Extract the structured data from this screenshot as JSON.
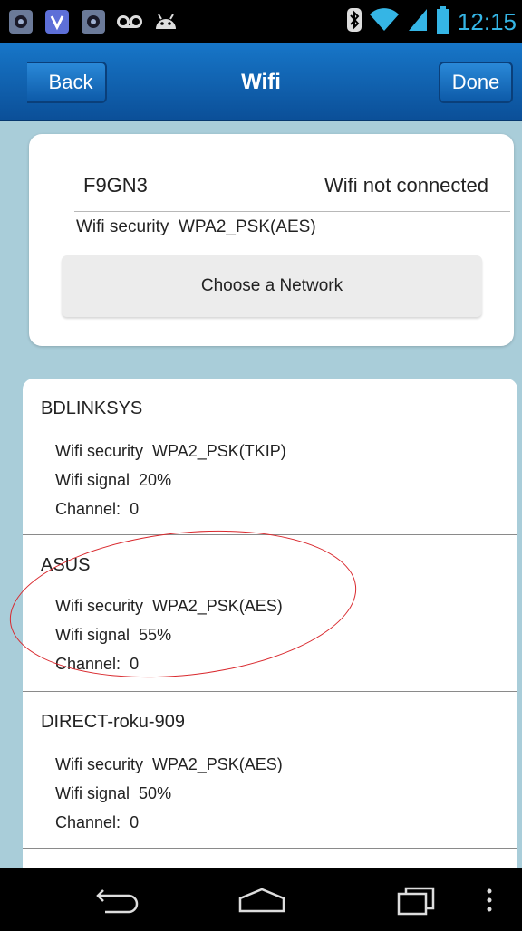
{
  "status_bar": {
    "time": "12:15",
    "left_icons": [
      "notification-icon",
      "shield-icon",
      "notification-icon",
      "voicemail-icon",
      "android-icon"
    ],
    "right_icons": [
      "bluetooth-icon",
      "wifi-icon",
      "cell-signal-icon",
      "battery-icon"
    ],
    "time_color": "#35b5e5"
  },
  "header": {
    "back_label": "Back",
    "title": "Wifi",
    "done_label": "Done"
  },
  "current": {
    "ssid": "F9GN3",
    "status": "Wifi not connected",
    "security_label": "Wifi security",
    "security_value": "WPA2_PSK(AES)",
    "choose_label": "Choose a Network"
  },
  "networks": [
    {
      "name": "BDLINKSYS",
      "security_label": "Wifi security",
      "security": "WPA2_PSK(TKIP)",
      "signal_label": "Wifi signal",
      "signal": "20%",
      "channel_label": "Channel:",
      "channel": "0"
    },
    {
      "name": "ASUS",
      "security_label": "Wifi security",
      "security": "WPA2_PSK(AES)",
      "signal_label": "Wifi signal",
      "signal": "55%",
      "channel_label": "Channel:",
      "channel": "0"
    },
    {
      "name": "DIRECT-roku-909",
      "security_label": "Wifi security",
      "security": "WPA2_PSK(AES)",
      "signal_label": "Wifi signal",
      "signal": "50%",
      "channel_label": "Channel:",
      "channel": "0"
    }
  ],
  "nav": {
    "icons": [
      "back-icon",
      "home-icon",
      "recent-apps-icon",
      "menu-icon"
    ]
  },
  "colors": {
    "header_blue": "#1776c8",
    "background": "#a9cdd9",
    "highlight": "#d9292e"
  }
}
